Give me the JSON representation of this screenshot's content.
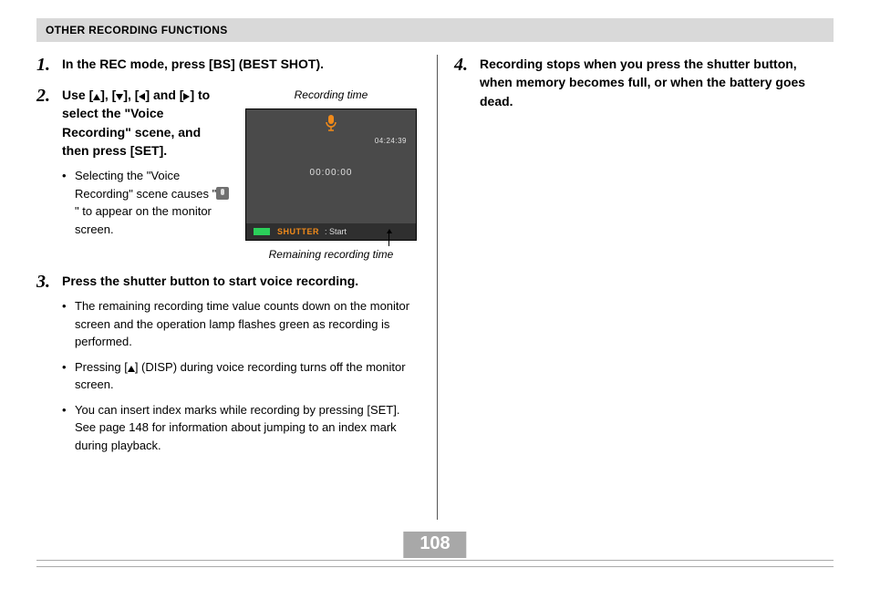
{
  "header": "OTHER RECORDING FUNCTIONS",
  "steps": {
    "s1": {
      "num": "1.",
      "text": "In the REC mode, press [BS] (BEST SHOT)."
    },
    "s2": {
      "num": "2.",
      "text_a": "Use [",
      "text_b": "], [",
      "text_c": "], [",
      "text_d": "] and [",
      "text_e": "] to select the \"Voice Recording\" scene, and then press [SET].",
      "bullet1_a": "Selecting the \"Voice Recording\" scene causes \"",
      "bullet1_b": "\" to appear on the monitor screen."
    },
    "s3": {
      "num": "3.",
      "text": "Press the shutter button to start voice recording.",
      "bullets": [
        "The remaining recording time value counts down on the monitor screen and the operation lamp flashes green as recording is performed.",
        "",
        "You can insert index marks while recording by pressing [SET]. See page 148 for information about jumping to an index mark during playback."
      ],
      "bullet2_a": "Pressing [",
      "bullet2_b": "] (DISP) during voice recording turns off the monitor screen."
    },
    "s4": {
      "num": "4.",
      "text": "Recording stops when you press the shutter button, when memory becomes full, or when the battery goes dead."
    }
  },
  "figure": {
    "label_top": "Recording time",
    "label_bottom": "Remaining recording time",
    "elapsed": "00:00:00",
    "remaining": "04:24:39",
    "shutter": "SHUTTER",
    "start": ": Start"
  },
  "page_number": "108"
}
